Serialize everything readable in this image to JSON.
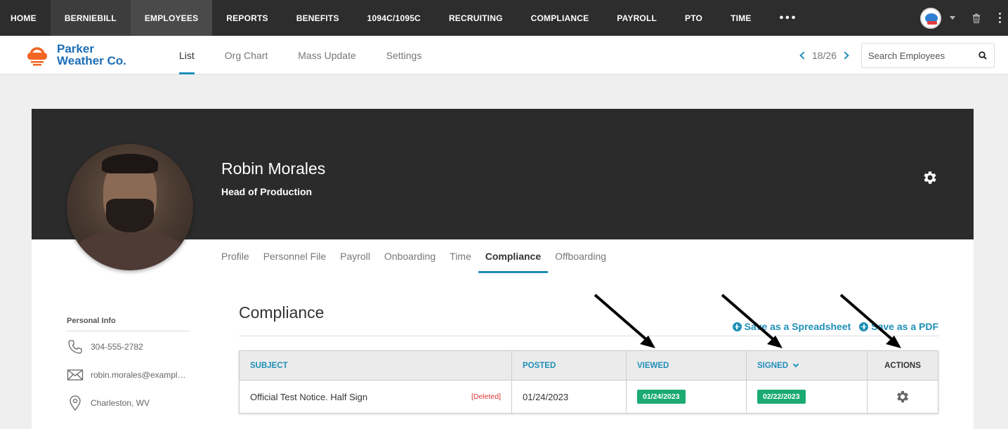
{
  "topnav": {
    "items": [
      "HOME",
      "BERNIEBILL",
      "EMPLOYEES",
      "REPORTS",
      "BENEFITS",
      "1094C/1095C",
      "RECRUITING",
      "COMPLIANCE",
      "PAYROLL",
      "PTO",
      "TIME"
    ],
    "more": "•••",
    "active": "EMPLOYEES"
  },
  "brand": {
    "line1": "Parker",
    "line2": "Weather Co.",
    "color": "#1b6db6",
    "accent": "#f26522"
  },
  "subtabs": [
    "List",
    "Org Chart",
    "Mass Update",
    "Settings"
  ],
  "pager": {
    "text": "18/26"
  },
  "search": {
    "placeholder": "Search Employees",
    "value": ""
  },
  "employee": {
    "name": "Robin Morales",
    "title": "Head of Production"
  },
  "profile_tabs": [
    "Profile",
    "Personnel File",
    "Payroll",
    "Onboarding",
    "Time",
    "Compliance",
    "Offboarding"
  ],
  "personal_info": {
    "heading": "Personal Info",
    "phone": "304-555-2782",
    "email": "robin.morales@example....",
    "location": "Charleston, WV"
  },
  "compliance": {
    "title": "Compliance",
    "export_spreadsheet": "Save as a Spreadsheet",
    "export_pdf": "Save as a PDF",
    "columns": [
      "SUBJECT",
      "POSTED",
      "VIEWED",
      "SIGNED",
      "ACTIONS"
    ],
    "rows": [
      {
        "subject": "Official Test Notice. Half Sign",
        "status": "[Deleted]",
        "posted": "01/24/2023",
        "viewed": "01/24/2023",
        "signed": "02/22/2023"
      }
    ]
  },
  "colors": {
    "accent": "#1f8fb8",
    "badge": "#1aaa72",
    "deleted": "#dd3333",
    "topnav": "#2d2d2d"
  }
}
